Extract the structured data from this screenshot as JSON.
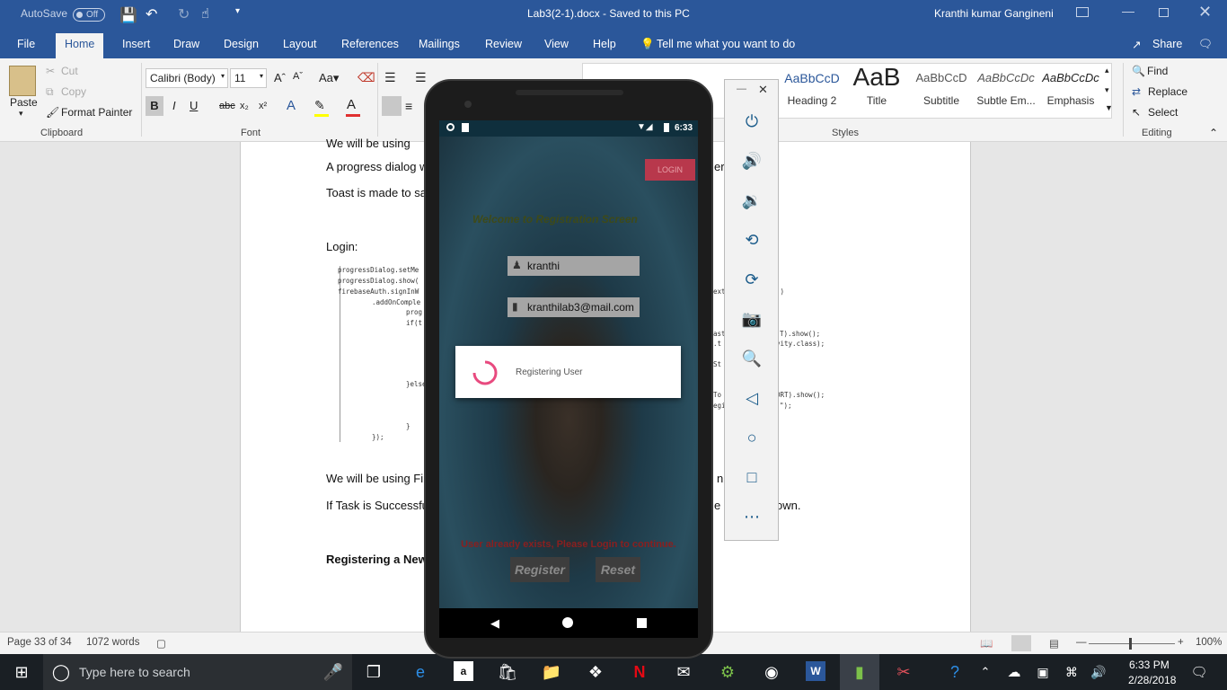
{
  "titlebar": {
    "autosave_label": "AutoSave",
    "autosave_state": "Off",
    "document_title": "Lab3(2-1).docx  -  Saved to this PC",
    "user_name": "Kranthi kumar Gangineni"
  },
  "ribbon_tabs": [
    "File",
    "Home",
    "Insert",
    "Draw",
    "Design",
    "Layout",
    "References",
    "Mailings",
    "Review",
    "View",
    "Help"
  ],
  "tell_me": "Tell me what you want to do",
  "share_label": "Share",
  "clipboard": {
    "paste": "Paste",
    "cut": "Cut",
    "copy": "Copy",
    "format_painter": "Format Painter",
    "group_label": "Clipboard"
  },
  "font": {
    "family": "Calibri (Body)",
    "size": "11",
    "group_label": "Font"
  },
  "styles": {
    "items": [
      {
        "preview": "AaBbCcD",
        "name": "Heading 2"
      },
      {
        "preview": "AaB",
        "name": "Title"
      },
      {
        "preview": "AaBbCcD",
        "name": "Subtitle"
      },
      {
        "preview": "AaBbCcDc",
        "name": "Subtle Em..."
      },
      {
        "preview": "AaBbCcDc",
        "name": "Emphasis"
      }
    ],
    "group_label": "Styles"
  },
  "editing": {
    "find": "Find",
    "replace": "Replace",
    "select": "Select",
    "group_label": "Editing"
  },
  "document": {
    "line_top": "We will be using",
    "line1": "A progress dialog w",
    "line1_tail": "er",
    "line2": "Toast is made to sa",
    "login_heading": "Login:",
    "code": [
      "progressDialog.setMe",
      "progressDialog.show(",
      "firebaseAuth.signInW",
      ".addOnComple",
      "prog",
      "if(t",
      "}else",
      "}",
      "});"
    ],
    "code_right": [
      "ext",
      "))",
      "ast",
      "T).show();",
      ".t",
      "vity.class);",
      "St",
      "To",
      "ORT).show();",
      "egi",
      "\");"
    ],
    "line3": "We will be using Fi",
    "line3_tail": "n",
    "line4": "If Task is Successfu",
    "line4_tail": "e",
    "line4_tail2": "own.",
    "registering_heading": "Registering a New"
  },
  "statusbar": {
    "page": "Page 33 of 34",
    "words": "1072 words",
    "zoom": "100%"
  },
  "taskbar": {
    "search_placeholder": "Type here to search",
    "time": "6:33 PM",
    "date": "2/28/2018"
  },
  "phone": {
    "time": "6:33",
    "login_button": "LOGIN",
    "welcome": "Welcome to Registration Screen",
    "name_value": "kranthi",
    "email_value": "kranthilab3@mail.com",
    "dialog_text": "Registering User",
    "error_text": "User already exists, Please Login to continue.",
    "register_button": "Register",
    "reset_button": "Reset"
  },
  "colors": {
    "word_blue": "#2b579a",
    "taskbar": "#1a1f24",
    "spinner": "#e84a7f",
    "login_button": "#b8384c",
    "welcome_text": "#3e4a18",
    "error_text": "#8a1f1f"
  }
}
